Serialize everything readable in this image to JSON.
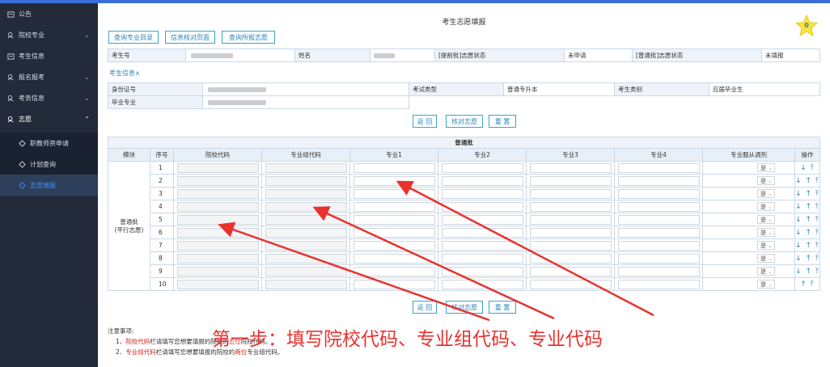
{
  "sidebar": {
    "items": [
      {
        "label": "公告",
        "icon": "notice-icon"
      },
      {
        "label": "院校专业",
        "icon": "school-icon",
        "chevron": "⌄"
      },
      {
        "label": "考生信息",
        "icon": "user-card-icon"
      },
      {
        "label": "报名报考",
        "icon": "signup-icon",
        "chevron": "⌄"
      },
      {
        "label": "考务信息",
        "icon": "exam-info-icon",
        "chevron": "⌄"
      },
      {
        "label": "志愿",
        "icon": "wish-icon",
        "chevron": "⌃"
      },
      {
        "label": "职教师资申请",
        "icon": "diamond-icon"
      },
      {
        "label": "计划查询",
        "icon": "diamond-icon"
      },
      {
        "label": "志愿填报",
        "icon": "diamond-icon"
      }
    ]
  },
  "page": {
    "title": "考生志愿填报",
    "star_count": "0"
  },
  "toolbar": {
    "buttons": [
      "查询专业目录",
      "信息核对页面",
      "查询所报志愿"
    ]
  },
  "info_row1": {
    "exam_no_label": "考生号",
    "name_label": "姓名",
    "early_status_label": "[提前批]志愿状态",
    "early_status_value": "未申请",
    "normal_status_label": "[普通批]志愿状态",
    "normal_status_value": "未填报"
  },
  "section": {
    "title": "考生信息∧"
  },
  "info_row2": {
    "id_label": "身份证号",
    "exam_type_label": "考试类型",
    "exam_type_value": "普通专升本",
    "category_label": "考生类别",
    "category_value": "应届毕业生",
    "grad_major_label": "毕业专业"
  },
  "actions": [
    "返 回",
    "核对志愿",
    "重 置"
  ],
  "grid": {
    "caption": "普通批",
    "headers": [
      "模块",
      "序号",
      "院校代码",
      "专业组代码",
      "专业1",
      "专业2",
      "专业3",
      "专业4",
      "专业服从调剂",
      "操作"
    ],
    "module_label": "普通批\n(平行志愿)",
    "rows": [
      "1",
      "2",
      "3",
      "4",
      "5",
      "6",
      "7",
      "8",
      "9",
      "10"
    ],
    "adjust_value": "是",
    "ops_symbol": "↓ ↑ ⤒",
    "ops_first": "↓ ⤒",
    "ops_last": "↑ ⤒"
  },
  "notes": {
    "title": "注意事项:",
    "line1_num": "1、",
    "line1_red1": "院校代码",
    "line1_mid": "栏请填写您想要填报的院校的",
    "line1_red2": "五位",
    "line1_end": "院校代码。",
    "line2_num": "2、",
    "line2_red1": "专业组代码",
    "line2_mid": "栏请填写您想要填报的院校的",
    "line2_red2": "两位",
    "line2_end": "专业组代码。"
  },
  "annotation": "第一步：填写院校代码、专业组代码、专业代码",
  "colors": {
    "accent": "#2a86b8",
    "sidebar": "#232b3a",
    "annotation": "#e8322e"
  }
}
